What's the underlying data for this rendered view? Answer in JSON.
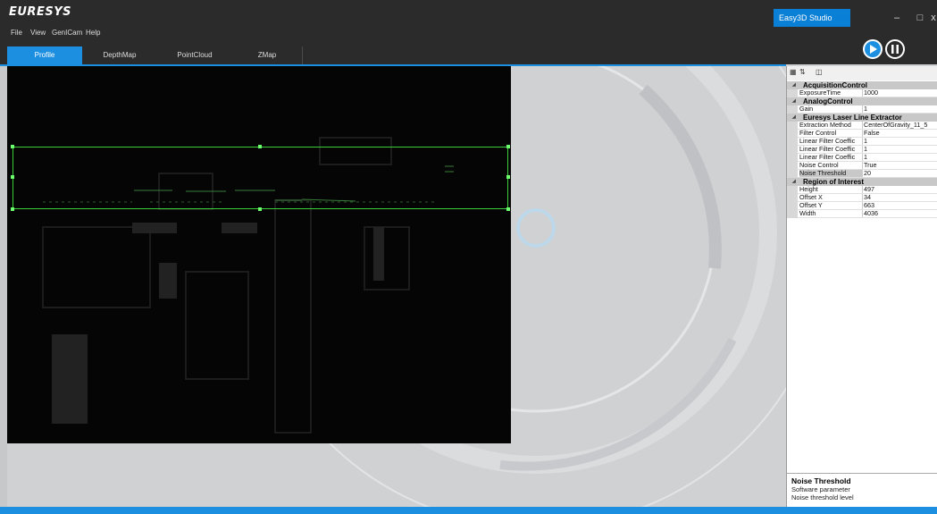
{
  "app": {
    "logo": "EURESYS",
    "title": "Easy3D Studio",
    "window_controls": [
      "–",
      "□",
      "x"
    ]
  },
  "menu": [
    "File",
    "View",
    "GenICam",
    "Help"
  ],
  "tabs": [
    {
      "label": "Profile",
      "active": true
    },
    {
      "label": "DepthMap",
      "active": false
    },
    {
      "label": "PointCloud",
      "active": false
    },
    {
      "label": "ZMap",
      "active": false
    }
  ],
  "controls": {
    "play_icon": "play-icon",
    "pause_icon": "pause-icon"
  },
  "properties": {
    "categories": [
      {
        "name": "AcquisitionControl",
        "rows": [
          {
            "key": "ExposureTime",
            "value": "1000"
          }
        ]
      },
      {
        "name": "AnalogControl",
        "rows": [
          {
            "key": "Gain",
            "value": "1"
          }
        ]
      },
      {
        "name": "Euresys Laser Line Extractor",
        "rows": [
          {
            "key": "Extraction Method",
            "value": "CenterOfGravity_11_5"
          },
          {
            "key": "Filter Control",
            "value": "False"
          },
          {
            "key": "Linear Filter Coeffic",
            "value": "1"
          },
          {
            "key": "Linear Filter Coeffic",
            "value": "1"
          },
          {
            "key": "Linear Filter Coeffic",
            "value": "1"
          },
          {
            "key": "Noise Control",
            "value": "True"
          },
          {
            "key": "Noise Threshold",
            "value": "20",
            "selected": true
          }
        ]
      },
      {
        "name": "Region of Interest",
        "rows": [
          {
            "key": "Height",
            "value": "497"
          },
          {
            "key": "Offset X",
            "value": "34"
          },
          {
            "key": "Offset Y",
            "value": "663"
          },
          {
            "key": "Width",
            "value": "4036"
          }
        ]
      }
    ]
  },
  "help": {
    "title": "Noise Threshold",
    "line1": "Software parameter",
    "line2": "Noise threshold level"
  },
  "colors": {
    "accent": "#1d8fe1",
    "roi": "#3ccf3c",
    "dark": "#2b2b2b"
  }
}
